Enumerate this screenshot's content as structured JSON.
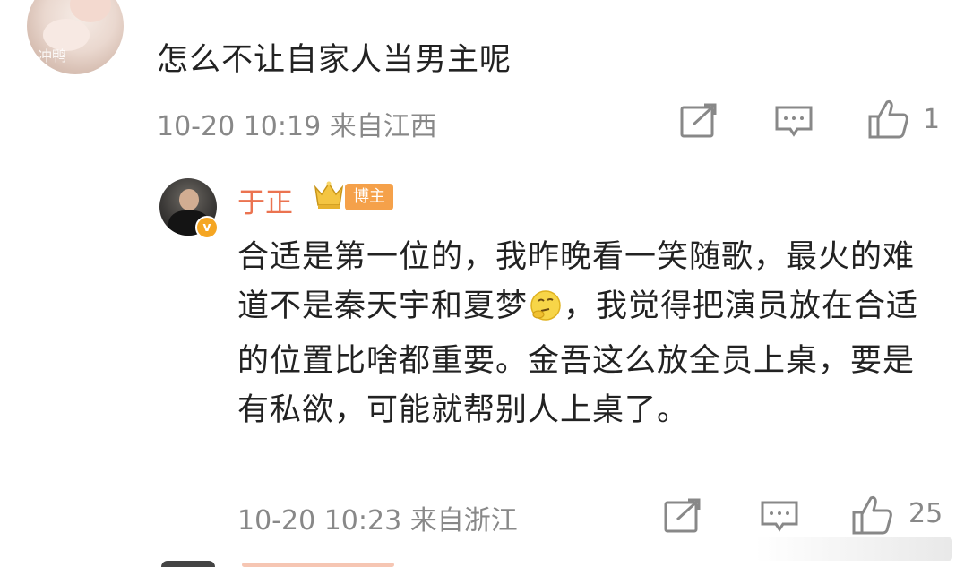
{
  "top_comment": {
    "avatar_watermark": "冲鸭",
    "text": "怎么不让自家人当男主呢",
    "time_location": "10-20 10:19 来自江西",
    "like_count": "1"
  },
  "reply": {
    "username": "于正",
    "badge": "博主",
    "verified_mark": "v",
    "text_before_emoji": "合适是第一位的，我昨晚看一笑随歌，最火的难道不是秦天宇和夏梦",
    "text_after_emoji": "，我觉得把演员放在合适的位置比啥都重要。金吾这么放全员上桌，要是有私欲，可能就帮别人上桌了。",
    "emoji": "thinking-face-icon",
    "time_location": "10-20 10:23 来自浙江",
    "like_count": "25"
  },
  "icons": [
    "share-icon",
    "comment-icon",
    "like-icon",
    "crown-icon"
  ],
  "colors": {
    "username": "#eb7350",
    "badge_bg": "#f5a14a",
    "meta_gray": "#888888",
    "text": "#222222"
  }
}
